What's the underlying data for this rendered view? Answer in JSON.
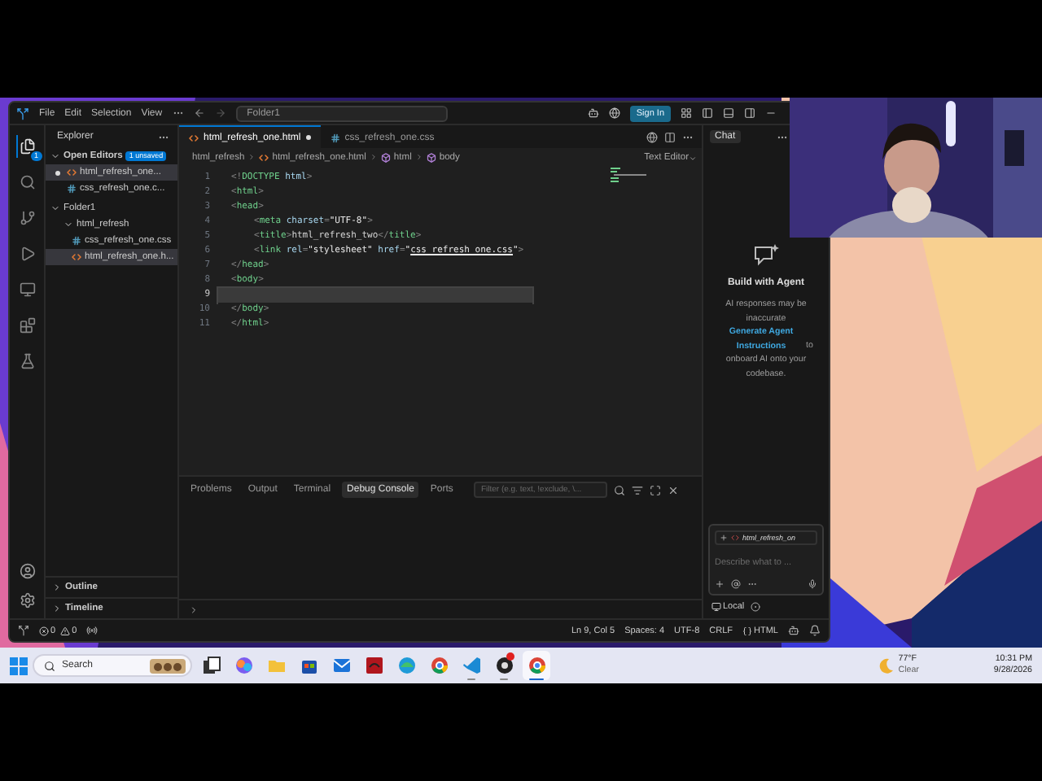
{
  "window": {
    "menu": [
      "File",
      "Edit",
      "Selection",
      "View"
    ],
    "command_center": "Folder1",
    "sign_in": "Sign In"
  },
  "activity_bar": [
    {
      "kind": "explorer",
      "selected": true,
      "badge": "1"
    },
    {
      "kind": "search",
      "selected": false
    },
    {
      "kind": "source-control",
      "selected": false
    },
    {
      "kind": "run",
      "selected": false
    },
    {
      "kind": "remote",
      "selected": false
    },
    {
      "kind": "extensions",
      "selected": false
    },
    {
      "kind": "python",
      "selected": false
    }
  ],
  "sidebar": {
    "title": "Explorer",
    "open_editors": {
      "title": "Open Editors",
      "badge": "1 unsaved",
      "expanded": true,
      "items": [
        {
          "kind": "html",
          "label": "html_refresh_one...",
          "dirty": true,
          "selected": true
        },
        {
          "kind": "css",
          "label": "css_refresh_one.c...",
          "dirty": false,
          "selected": false
        }
      ]
    },
    "folder": {
      "label": "Folder1",
      "expanded": true,
      "children": [
        {
          "kind": "folder",
          "label": "html_refresh",
          "expanded": true,
          "selected": false,
          "children": [
            {
              "kind": "css",
              "label": "css_refresh_one.css",
              "selected": false
            },
            {
              "kind": "html",
              "label": "html_refresh_one.h...",
              "selected": true
            }
          ]
        }
      ]
    },
    "sections": [
      {
        "label": "Outline",
        "expanded": false
      },
      {
        "label": "Timeline",
        "expanded": false
      }
    ]
  },
  "editor": {
    "tabs": [
      {
        "kind": "html",
        "label": "html_refresh_one.html",
        "dirty": true,
        "selected": true
      },
      {
        "kind": "css",
        "label": "css_refresh_one.css",
        "dirty": false,
        "selected": false
      }
    ],
    "breadcrumbs": [
      {
        "kind": "folder",
        "label": "html_refresh"
      },
      {
        "kind": "html",
        "label": "html_refresh_one.html"
      },
      {
        "kind": "element",
        "label": "html"
      },
      {
        "kind": "element",
        "label": "body"
      }
    ],
    "mode": "Text Editor",
    "lines": [
      {
        "number": "1",
        "current": false,
        "indent": false,
        "tokens": [
          {
            "kind": "punct",
            "text": "<!"
          },
          {
            "kind": "tag",
            "text": "DOCTYPE"
          },
          {
            "kind": "attr",
            "text": " html"
          },
          {
            "kind": "punct",
            "text": ">"
          }
        ]
      },
      {
        "number": "2",
        "current": false,
        "indent": false,
        "tokens": [
          {
            "kind": "punct",
            "text": "<"
          },
          {
            "kind": "tag",
            "text": "html"
          },
          {
            "kind": "punct",
            "text": ">"
          }
        ]
      },
      {
        "number": "3",
        "current": false,
        "indent": false,
        "tokens": [
          {
            "kind": "punct",
            "text": "<"
          },
          {
            "kind": "tag",
            "text": "head"
          },
          {
            "kind": "punct",
            "text": ">"
          }
        ]
      },
      {
        "number": "4",
        "current": false,
        "indent": true,
        "tokens": [
          {
            "kind": "punct",
            "text": "<"
          },
          {
            "kind": "tag",
            "text": "meta"
          },
          {
            "kind": "attr",
            "text": " charset"
          },
          {
            "kind": "punct",
            "text": "="
          },
          {
            "kind": "string",
            "text": "\"UTF-8\""
          },
          {
            "kind": "punct",
            "text": ">"
          }
        ]
      },
      {
        "number": "5",
        "current": false,
        "indent": true,
        "tokens": [
          {
            "kind": "punct",
            "text": "<"
          },
          {
            "kind": "tag",
            "text": "title"
          },
          {
            "kind": "punct",
            "text": ">"
          },
          {
            "kind": "text",
            "text": "html_refresh_two"
          },
          {
            "kind": "punct",
            "text": "</"
          },
          {
            "kind": "tag",
            "text": "title"
          },
          {
            "kind": "punct",
            "text": ">"
          }
        ]
      },
      {
        "number": "6",
        "current": false,
        "indent": true,
        "tokens": [
          {
            "kind": "punct",
            "text": "<"
          },
          {
            "kind": "tag",
            "text": "link"
          },
          {
            "kind": "attr",
            "text": " rel"
          },
          {
            "kind": "punct",
            "text": "="
          },
          {
            "kind": "string",
            "text": "\"stylesheet\""
          },
          {
            "kind": "attr",
            "text": " href"
          },
          {
            "kind": "punct",
            "text": "="
          },
          {
            "kind": "string",
            "text": "\""
          },
          {
            "kind": "link",
            "text": "css_refresh_one.css"
          },
          {
            "kind": "string",
            "text": "\""
          },
          {
            "kind": "punct",
            "text": ">"
          }
        ]
      },
      {
        "number": "7",
        "current": false,
        "indent": false,
        "tokens": [
          {
            "kind": "punct",
            "text": "</"
          },
          {
            "kind": "tag",
            "text": "head"
          },
          {
            "kind": "punct",
            "text": ">"
          }
        ]
      },
      {
        "number": "8",
        "current": false,
        "indent": false,
        "tokens": [
          {
            "kind": "punct",
            "text": "<"
          },
          {
            "kind": "tag",
            "text": "body"
          },
          {
            "kind": "punct",
            "text": ">"
          }
        ]
      },
      {
        "number": "9",
        "current": true,
        "indent": false
      },
      {
        "number": "10",
        "current": false,
        "indent": false,
        "tokens": [
          {
            "kind": "punct",
            "text": "</"
          },
          {
            "kind": "tag",
            "text": "body"
          },
          {
            "kind": "punct",
            "text": ">"
          }
        ]
      },
      {
        "number": "11",
        "current": false,
        "indent": false,
        "tokens": [
          {
            "kind": "punct",
            "text": "</"
          },
          {
            "kind": "tag",
            "text": "html"
          },
          {
            "kind": "punct",
            "text": ">"
          }
        ]
      }
    ]
  },
  "panel": {
    "tabs": [
      {
        "label": "Problems",
        "selected": false
      },
      {
        "label": "Output",
        "selected": false
      },
      {
        "label": "Terminal",
        "selected": false
      },
      {
        "label": "Debug Console",
        "selected": true
      },
      {
        "label": "Ports",
        "selected": false
      }
    ],
    "filter_placeholder": "Filter (e.g. text, !exclude, \\..."
  },
  "chat": {
    "title": "Chat",
    "heading": "Build with Agent",
    "note": {
      "before": "AI responses may be inaccurate",
      "link": "Generate Agent Instructions",
      "after": "to onboard AI onto your codebase."
    },
    "attachment": "html_refresh_on",
    "input_placeholder": "Describe what to ...",
    "mode": "Local"
  },
  "status_bar": {
    "errors": "0",
    "warnings": "0",
    "items": [
      {
        "kind": "text",
        "label": "Ln 9, Col 5"
      },
      {
        "kind": "text",
        "label": "Spaces: 4"
      },
      {
        "kind": "text",
        "label": "UTF-8"
      },
      {
        "kind": "text",
        "label": "CRLF"
      },
      {
        "kind": "language",
        "label": "HTML"
      }
    ]
  },
  "taskbar": {
    "search": "Search",
    "apps": [
      {
        "kind": "taskview",
        "running": false,
        "selected": false,
        "alert": false
      },
      {
        "kind": "copilot",
        "running": false,
        "selected": false,
        "alert": false
      },
      {
        "kind": "files",
        "running": false,
        "selected": false,
        "alert": false
      },
      {
        "kind": "store",
        "running": false,
        "selected": false,
        "alert": false
      },
      {
        "kind": "mail",
        "running": false,
        "selected": false,
        "alert": false
      },
      {
        "kind": "game",
        "running": false,
        "selected": false,
        "alert": false
      },
      {
        "kind": "edge",
        "running": false,
        "selected": false,
        "alert": false
      },
      {
        "kind": "chrome",
        "running": false,
        "selected": false,
        "alert": false
      },
      {
        "kind": "vscode",
        "running": true,
        "selected": false,
        "alert": false
      },
      {
        "kind": "obs",
        "running": true,
        "selected": false,
        "alert": true
      },
      {
        "kind": "chrome",
        "running": true,
        "selected": true,
        "alert": false
      }
    ],
    "weather": {
      "temp": "77°F",
      "condition": "Clear"
    },
    "clock": {
      "time": "10:31 PM",
      "date": "9/28/2026"
    }
  }
}
